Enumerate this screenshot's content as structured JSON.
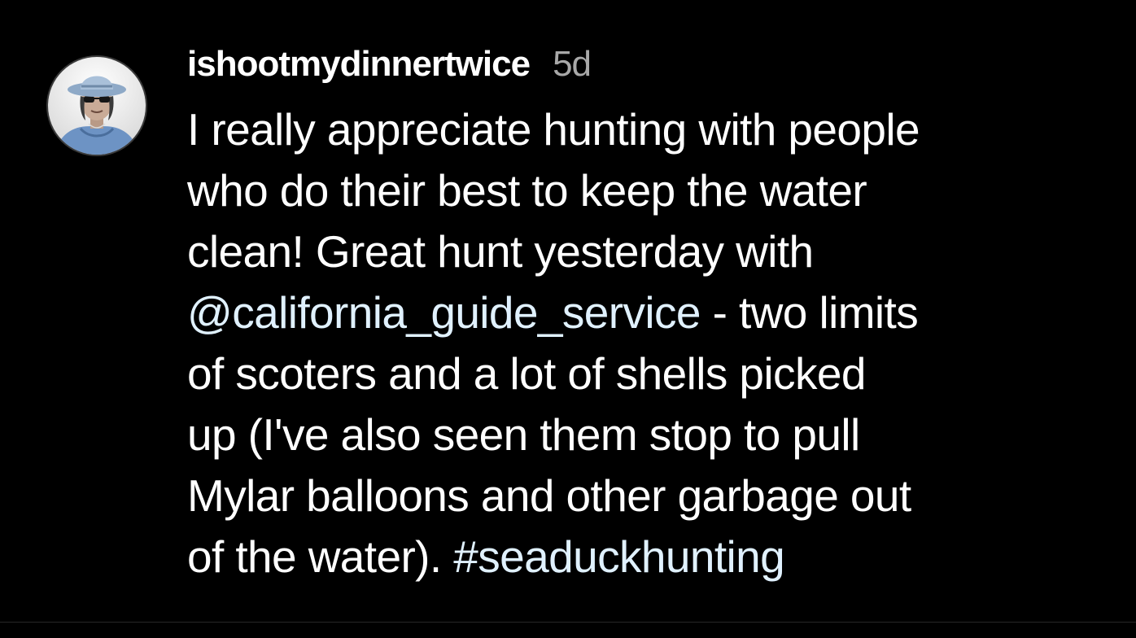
{
  "comment": {
    "username": "ishootmydinnertwice",
    "timestamp": "5d",
    "avatar_icon": "user-avatar-photo",
    "text_lines": [
      {
        "pre": "I really appreciate hunting with people",
        "link": "",
        "post": ""
      },
      {
        "pre": "who do their best to keep the water",
        "link": "",
        "post": ""
      },
      {
        "pre": "clean! Great hunt yesterday with",
        "link": "",
        "post": ""
      },
      {
        "pre": "",
        "link": "@california_guide_service",
        "post": " - two limits"
      },
      {
        "pre": "of scoters and a lot of shells picked",
        "link": "",
        "post": ""
      },
      {
        "pre": "up (I've also seen them stop to pull",
        "link": "",
        "post": ""
      },
      {
        "pre": "Mylar balloons and other garbage out",
        "link": "",
        "post": ""
      },
      {
        "pre": "of the water). ",
        "link": "#seaduckhunting",
        "post": ""
      }
    ]
  },
  "colors": {
    "background": "#000000",
    "text": "#ffffff",
    "timestamp": "#a8a8a8",
    "link": "#e0f1ff"
  }
}
